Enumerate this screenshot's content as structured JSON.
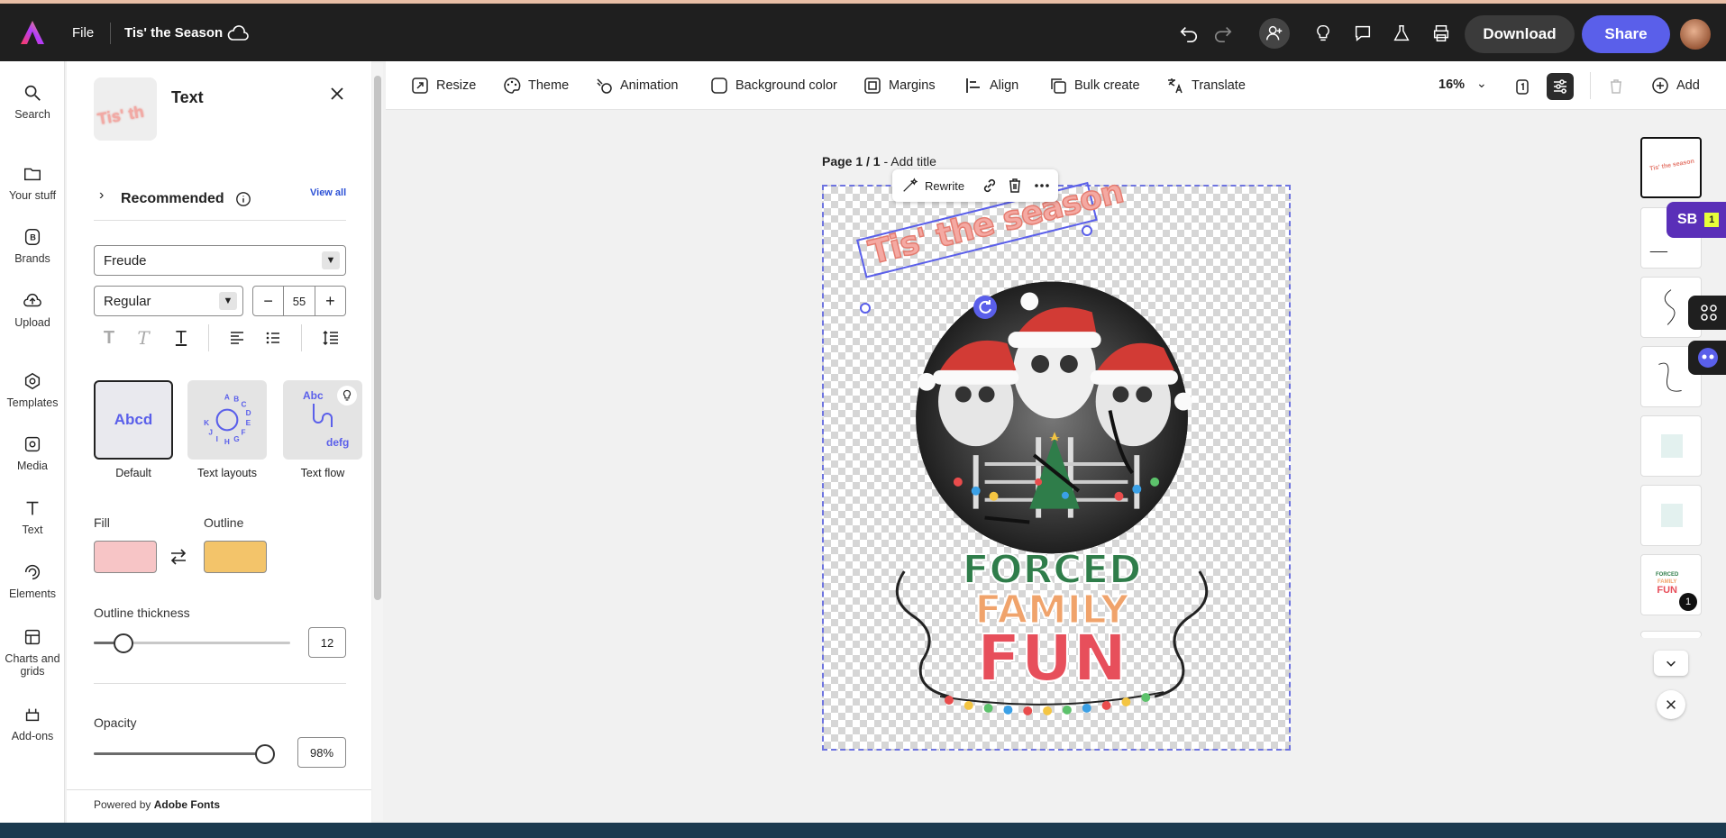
{
  "header": {
    "file_label": "File",
    "doc_title": "Tis' the Season",
    "download_label": "Download",
    "share_label": "Share"
  },
  "rail": {
    "items": [
      {
        "label": "Search",
        "icon": "search-icon"
      },
      {
        "label": "Your stuff",
        "icon": "folder-icon"
      },
      {
        "label": "Brands",
        "icon": "brand-icon"
      },
      {
        "label": "Upload",
        "icon": "upload-icon"
      },
      {
        "label": "Templates",
        "icon": "templates-icon"
      },
      {
        "label": "Media",
        "icon": "media-icon"
      },
      {
        "label": "Text",
        "icon": "text-icon"
      },
      {
        "label": "Elements",
        "icon": "elements-icon"
      },
      {
        "label": "Charts and grids",
        "icon": "charts-icon"
      },
      {
        "label": "Add-ons",
        "icon": "addons-icon"
      }
    ]
  },
  "panel": {
    "thumb_text": "Tis' th",
    "title": "Text",
    "recommended_label": "Recommended",
    "view_all_label": "View all",
    "font_family": "Freude",
    "font_weight": "Regular",
    "font_size": "55",
    "styles": [
      {
        "label": "Default",
        "sample": "Abcd"
      },
      {
        "label": "Text layouts",
        "sample": "ABCDEFGHIJK"
      },
      {
        "label": "Text flow",
        "sample_top": "Abc",
        "sample_bottom": "defg"
      }
    ],
    "fill_label": "Fill",
    "outline_label": "Outline",
    "fill_color": "#f7c5c6",
    "outline_color": "#f3c46a",
    "outline_thickness_label": "Outline thickness",
    "outline_thickness_value": "12",
    "outline_thickness_fraction": 0.15,
    "opacity_label": "Opacity",
    "opacity_value": "98%",
    "opacity_fraction": 0.98,
    "powered_prefix": "Powered by ",
    "powered_brand": "Adobe Fonts"
  },
  "toolbar": {
    "tools": [
      {
        "label": "Resize",
        "icon": "resize-icon"
      },
      {
        "label": "Theme",
        "icon": "palette-icon"
      },
      {
        "label": "Animation",
        "icon": "animation-icon"
      },
      {
        "label": "Background color",
        "icon": "background-color-icon"
      },
      {
        "label": "Margins",
        "icon": "margins-icon"
      },
      {
        "label": "Align",
        "icon": "align-icon"
      },
      {
        "label": "Bulk create",
        "icon": "bulk-create-icon"
      },
      {
        "label": "Translate",
        "icon": "translate-icon"
      }
    ],
    "zoom": "16%",
    "add_label": "Add"
  },
  "canvas": {
    "page_label_bold": "Page 1 / 1",
    "page_label_rest": " - Add title",
    "rewrite_label": "Rewrite",
    "headline": "Tis' the season",
    "art_line1": "FORCED",
    "art_line2": "FAMILY",
    "art_line3": "FUN"
  },
  "right": {
    "sb_label": "SB",
    "sb_count": "1",
    "page_badge": "1"
  },
  "colors": {
    "accent": "#5a5fea",
    "topbar": "#1f1f1f",
    "headline_fill": "#f4a9a2",
    "headline_stroke": "#e57c70"
  }
}
